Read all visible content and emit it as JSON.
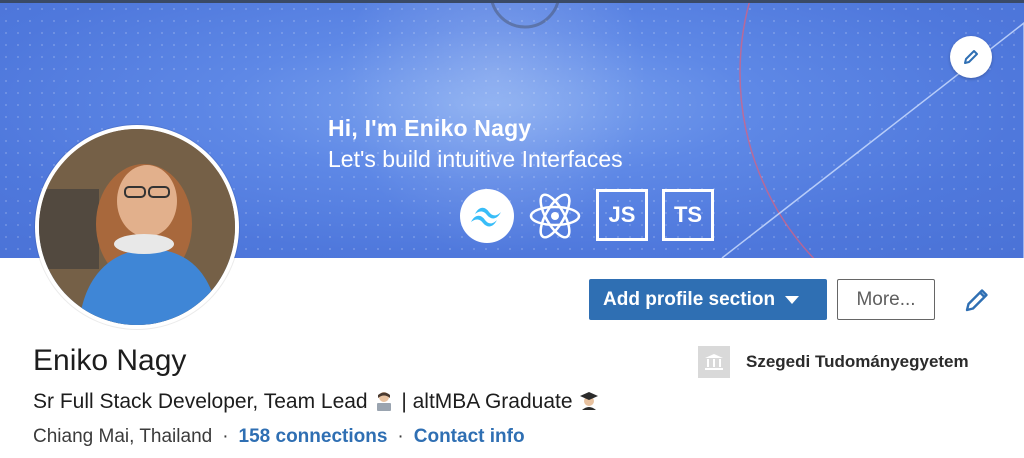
{
  "banner": {
    "greeting": "Hi, I'm Eniko Nagy",
    "tagline": "Let's build intuitive Interfaces",
    "tech": [
      {
        "icon": "tailwind-icon",
        "label": ""
      },
      {
        "icon": "react-icon",
        "label": ""
      },
      {
        "icon": "javascript-icon",
        "label": "JS"
      },
      {
        "icon": "typescript-icon",
        "label": "TS"
      }
    ]
  },
  "actions": {
    "add_section_label": "Add profile section",
    "more_label": "More..."
  },
  "profile": {
    "name": "Eniko Nagy",
    "headline_part1": "Sr Full Stack Developer, Team Lead",
    "headline_part2": " | altMBA Graduate",
    "location": "Chiang Mai, Thailand",
    "separator": "·",
    "connections": "158 connections",
    "contact": "Contact info"
  },
  "education": {
    "school": "Szegedi Tudományegyetem"
  },
  "colors": {
    "accent": "#2f6fb3",
    "banner": "#4f78dc"
  }
}
